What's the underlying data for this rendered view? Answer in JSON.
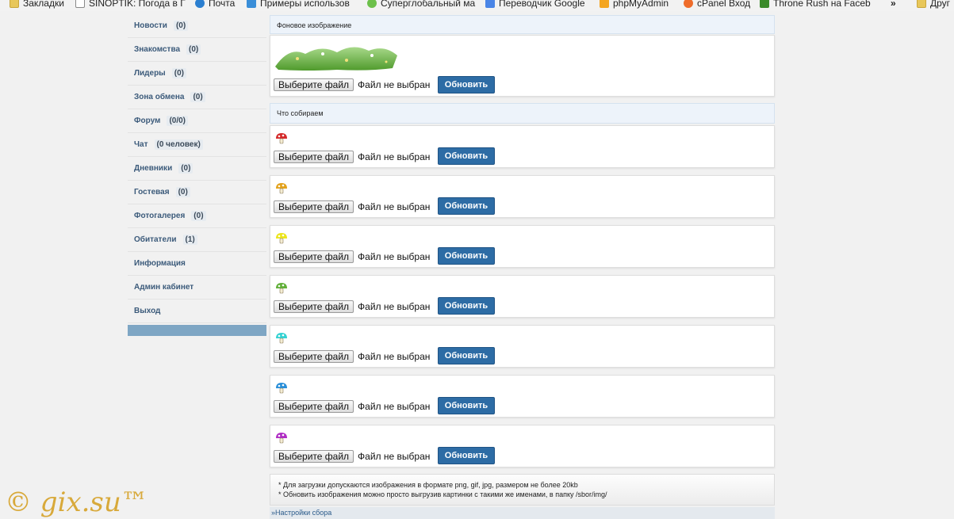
{
  "bookmarks": [
    {
      "label": "Закладки",
      "icon": "folder-icon"
    },
    {
      "label": "SINOPTIK: Погода в Г",
      "icon": "thermometer-icon"
    },
    {
      "label": "Почта",
      "icon": "mail-icon"
    },
    {
      "label": "Примеры использов",
      "icon": "w-site-icon"
    },
    {
      "label": "Суперглобальный ма",
      "icon": "checkmark-icon"
    },
    {
      "label": "Переводчик Google",
      "icon": "translate-icon"
    },
    {
      "label": "phpMyAdmin",
      "icon": "pma-icon"
    },
    {
      "label": "cPanel Вход",
      "icon": "cpanel-icon"
    },
    {
      "label": "Throne Rush на Faceb",
      "icon": "castle-icon"
    },
    {
      "label": "»",
      "icon": ""
    },
    {
      "label": "Друг",
      "icon": "folder-icon"
    }
  ],
  "sidebar": {
    "items": [
      {
        "label": "Новости",
        "count": "(0)"
      },
      {
        "label": "Знакомства",
        "count": "(0)"
      },
      {
        "label": "Лидеры",
        "count": "(0)"
      },
      {
        "label": "Зона обмена",
        "count": "(0)"
      },
      {
        "label": "Форум",
        "count": "(0/0)"
      },
      {
        "label": "Чат",
        "count": "(0 человек)"
      },
      {
        "label": "Дневники",
        "count": "(0)"
      },
      {
        "label": "Гостевая",
        "count": "(0)"
      },
      {
        "label": "Фотогалерея",
        "count": "(0)"
      },
      {
        "label": "Обитатели",
        "count": "(1)"
      },
      {
        "label": "Информация",
        "count": ""
      },
      {
        "label": "Админ кабинет",
        "count": ""
      },
      {
        "label": "Выход",
        "count": ""
      }
    ]
  },
  "background_section": {
    "title": "Фоновое изображение"
  },
  "collect_section": {
    "title": "Что собираем"
  },
  "file": {
    "choose_label": "Выберите файл",
    "no_file_label": "Файл не выбран",
    "update_label": "Обновить"
  },
  "mushrooms": [
    {
      "color": "#d42a2a"
    },
    {
      "color": "#e3a21c"
    },
    {
      "color": "#ece51c"
    },
    {
      "color": "#62b03a"
    },
    {
      "color": "#36d2d2"
    },
    {
      "color": "#2a8fd8"
    },
    {
      "color": "#b02ec4"
    }
  ],
  "notes": [
    "* Для загрузки допускаются изображения в формате png, gif, jpg, размером не более 20kb",
    "* Обновить изображения можно просто выгрузив картинки с такими же именами, в папку /sbor/img/"
  ],
  "footer": {
    "link": "»Настройки сбора"
  },
  "copyright": "© gix.su™",
  "colors": {
    "accent": "#2d6ca5",
    "nav_text": "#3b5a7a",
    "section_bg": "#edf3fa",
    "brand": "#d8a93a"
  }
}
